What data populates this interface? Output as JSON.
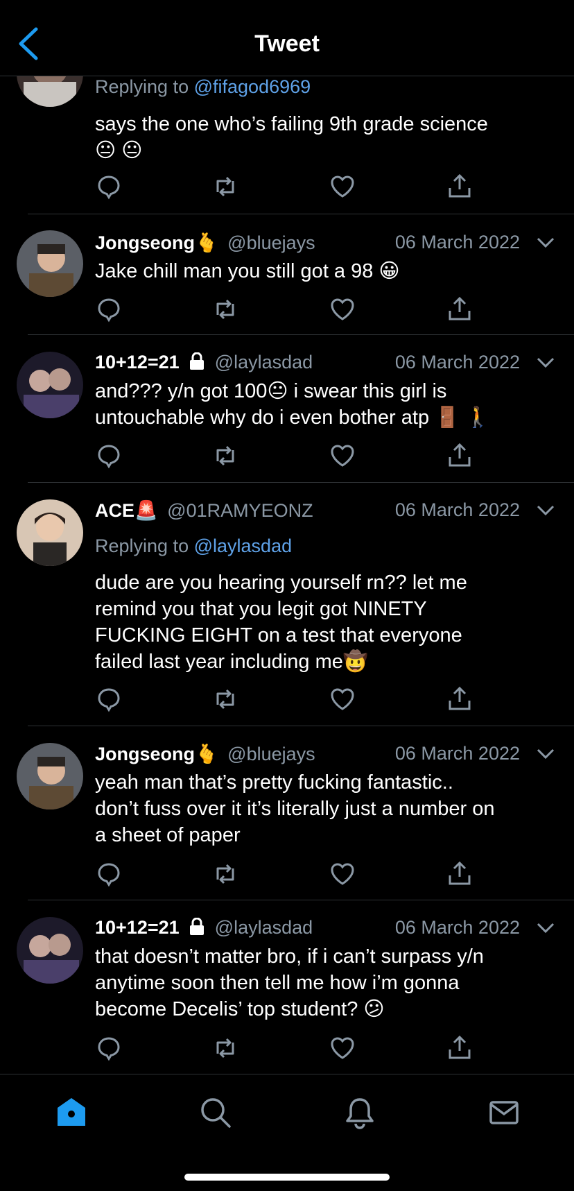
{
  "header": {
    "title": "Tweet"
  },
  "tweets": [
    {
      "reply_prefix": "Replying to",
      "reply_to": "@fifagod6969",
      "lines": [
        "says the one who’s failing 9th grade science"
      ],
      "emoji_line": "😐 😐"
    },
    {
      "name": "Jongseong",
      "name_emoji": "🫰",
      "handle": "@bluejays",
      "date": "06 March 2022",
      "lines": [
        "Jake chill man you still got a 98 😀"
      ]
    },
    {
      "name": "10+12=21",
      "handle": "@laylasdad",
      "date": "06 March 2022",
      "lines": [
        "and??? y/n got 100😐  i swear this girl is",
        "untouchable why do i even bother atp 🚪 🚶"
      ]
    },
    {
      "name": "ACE",
      "name_emoji": "🚨",
      "handle": "@01RAMYEONZ",
      "date": "06 March 2022",
      "reply_prefix": "Replying to",
      "reply_to": "@laylasdad",
      "lines": [
        "dude are you hearing yourself rn?? let me",
        "remind you that you legit got NINETY",
        "FUCKING EIGHT on a test that everyone",
        "failed last year including me🤠"
      ]
    },
    {
      "name": "Jongseong",
      "name_emoji": "🫰",
      "handle": "@bluejays",
      "date": "06 March 2022",
      "lines": [
        "yeah man that’s pretty fucking fantastic..",
        "don’t fuss over it it’s literally just a number on",
        "a sheet of paper"
      ]
    },
    {
      "name": "10+12=21",
      "handle": "@laylasdad",
      "date": "06 March 2022",
      "lines": [
        "that doesn’t matter bro, if i can’t surpass y/n",
        "anytime soon then tell me how i’m gonna",
        "become Decelis’ top student? 😕"
      ]
    }
  ],
  "colors": {
    "accent": "#1d9bf0",
    "muted": "#8b98a5",
    "link": "#5fa2e8",
    "background": "#000000"
  },
  "nav": {
    "items": [
      "home-icon",
      "search-icon",
      "notifications-icon",
      "messages-icon"
    ],
    "active": "home-icon"
  }
}
